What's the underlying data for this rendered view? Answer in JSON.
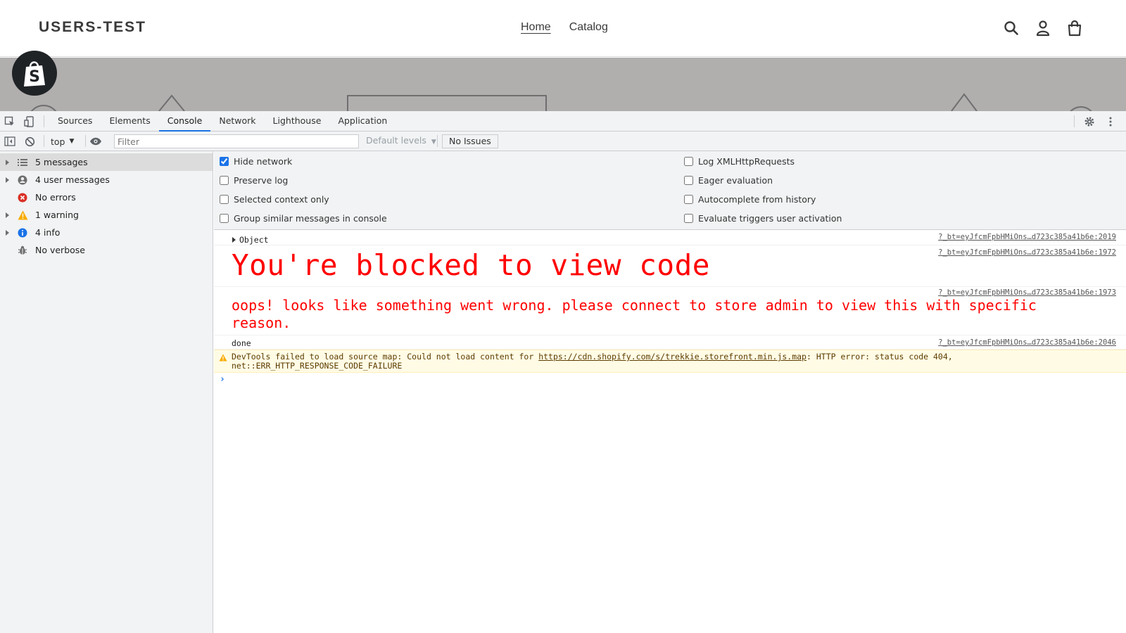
{
  "store": {
    "logo": "USERS-TEST",
    "nav": [
      {
        "label": "Home"
      },
      {
        "label": "Catalog"
      }
    ],
    "icons": [
      "search-icon",
      "account-icon",
      "cart-icon"
    ]
  },
  "devtools": {
    "tabs": [
      "Sources",
      "Elements",
      "Console",
      "Network",
      "Lighthouse",
      "Application"
    ],
    "active_tab": "Console",
    "toolbar": {
      "context": "top",
      "filter_placeholder": "Filter",
      "levels": "Default levels",
      "issues": "No Issues"
    },
    "sidebar": [
      {
        "label": "5 messages",
        "icon": "list-icon",
        "expandable": true,
        "selected": true
      },
      {
        "label": "4 user messages",
        "icon": "user-icon",
        "expandable": true,
        "selected": false
      },
      {
        "label": "No errors",
        "icon": "error-icon",
        "expandable": false,
        "selected": false
      },
      {
        "label": "1 warning",
        "icon": "warning-icon",
        "expandable": true,
        "selected": false
      },
      {
        "label": "4 info",
        "icon": "info-icon",
        "expandable": true,
        "selected": false
      },
      {
        "label": "No verbose",
        "icon": "verbose-icon",
        "expandable": false,
        "selected": false
      }
    ],
    "settings_left": [
      {
        "label": "Hide network",
        "checked": true
      },
      {
        "label": "Preserve log",
        "checked": false
      },
      {
        "label": "Selected context only",
        "checked": false
      },
      {
        "label": "Group similar messages in console",
        "checked": false
      }
    ],
    "settings_right": [
      {
        "label": "Log XMLHttpRequests",
        "checked": false
      },
      {
        "label": "Eager evaluation",
        "checked": false
      },
      {
        "label": "Autocomplete from history",
        "checked": false
      },
      {
        "label": "Evaluate triggers user activation",
        "checked": false
      }
    ],
    "messages": {
      "object": {
        "text": "Object",
        "source": "?_bt=eyJfcmFpbHMiOns…d723c385a41b6e:2019"
      },
      "blocked": {
        "text": "You're blocked to view code",
        "source": "?_bt=eyJfcmFpbHMiOns…d723c385a41b6e:1972"
      },
      "oops": {
        "text": "oops! looks like something went wrong. please connect to store admin to view this with specific reason.",
        "source": "?_bt=eyJfcmFpbHMiOns…d723c385a41b6e:1973"
      },
      "done": {
        "text": "done",
        "source": "?_bt=eyJfcmFpbHMiOns…d723c385a41b6e:2046"
      },
      "warning": {
        "prefix": "DevTools failed to load source map: Could not load content for ",
        "link": "https://cdn.shopify.com/s/trekkie.storefront.min.js.map",
        "suffix": ": HTTP error: status code 404,",
        "line2": "net::ERR_HTTP_RESPONSE_CODE_FAILURE"
      },
      "prompt": "›"
    },
    "colors": {
      "accent": "#1a73e8",
      "error_text": "#ff0000",
      "warning_bg": "#fffbe5"
    }
  }
}
